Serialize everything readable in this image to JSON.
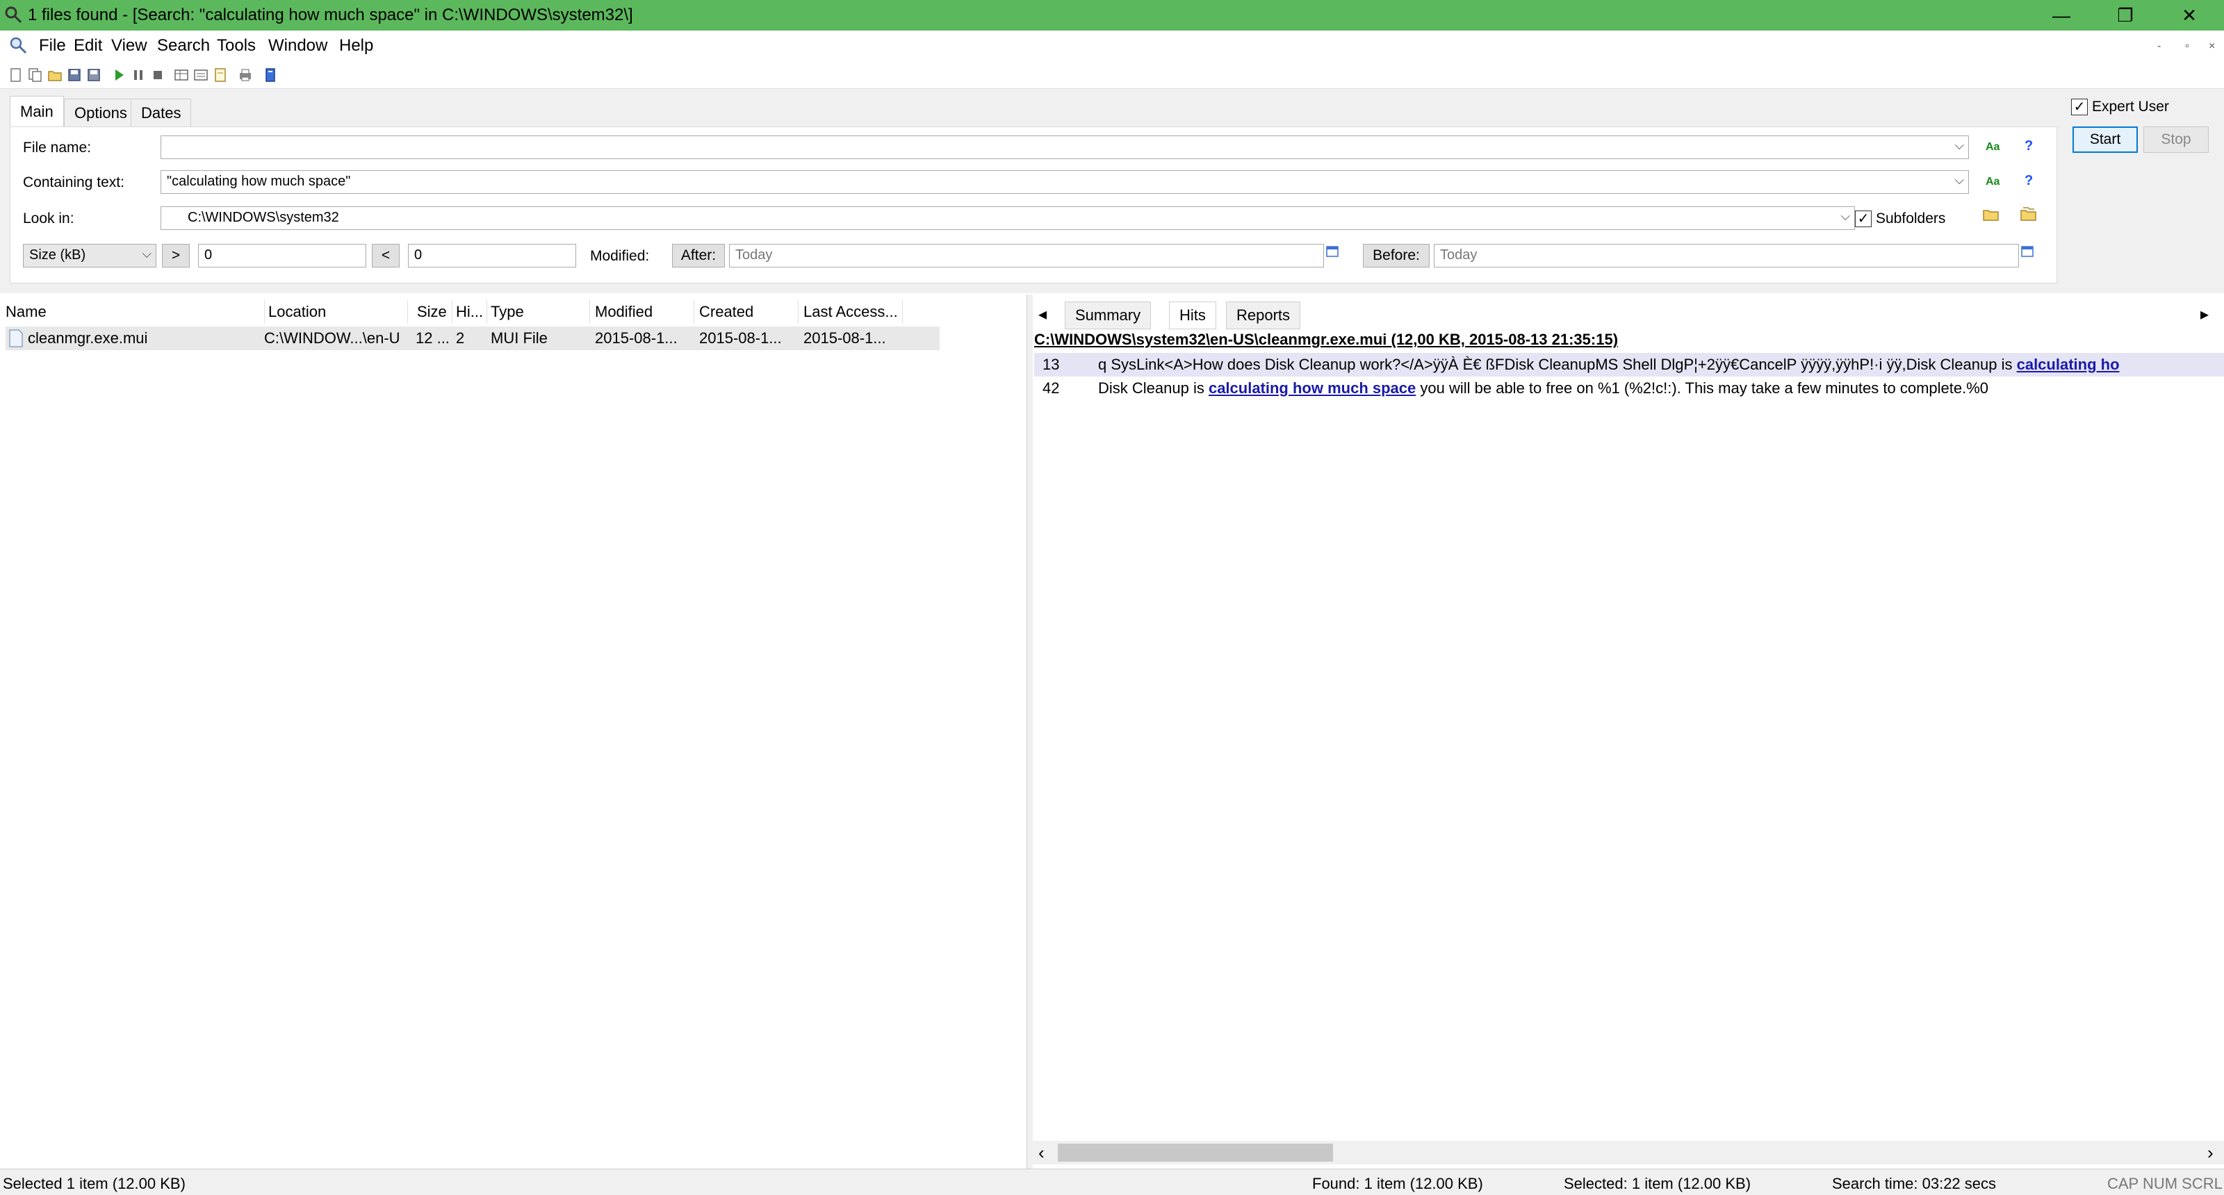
{
  "window": {
    "title": "1 files found - [Search: \"calculating how much space\" in C:\\WINDOWS\\system32\\]",
    "minimize": "—",
    "restore": "❐",
    "close": "✕",
    "title_bar_color": "#5cb85c"
  },
  "menu": {
    "items": [
      "File",
      "Edit",
      "View",
      "Search",
      "Tools",
      "Window",
      "Help"
    ],
    "mdi_controls": [
      "-",
      "▫",
      "×"
    ]
  },
  "toolbar": {
    "icons": [
      "new-icon",
      "new-from-icon",
      "open-icon",
      "save-icon",
      "save-as-icon",
      "start-icon",
      "pause-icon",
      "stop-icon",
      "grid-icon",
      "report-icon",
      "export-icon",
      "print-icon",
      "info-icon"
    ]
  },
  "search_tabs": [
    "Main",
    "Options",
    "Dates"
  ],
  "search": {
    "file_name_label": "File name:",
    "file_name_value": "",
    "containing_text_label": "Containing text:",
    "containing_text_value": "\"calculating how much space\"",
    "look_in_label": "Look in:",
    "look_in_value": "C:\\WINDOWS\\system32",
    "subfolders_label": "Subfolders",
    "subfolders_checked": true,
    "size_unit": "Size (kB)",
    "greater_than": ">",
    "greater_value": "0",
    "less_than": "<",
    "less_value": "0",
    "modified_label": "Modified:",
    "after_label": "After:",
    "after_value": "Today",
    "before_label": "Before:",
    "before_value": "Today",
    "case_icon": "Aa",
    "help_icon": "?"
  },
  "actions": {
    "expert_user_label": "Expert User",
    "expert_user_checked": true,
    "start_label": "Start",
    "stop_label": "Stop"
  },
  "results": {
    "columns": [
      "Name",
      "Location",
      "Size",
      "Hi...",
      "Type",
      "Modified",
      "Created",
      "Last Access..."
    ],
    "rows": [
      {
        "name": "cleanmgr.exe.mui",
        "location": "C:\\WINDOW...\\en-U",
        "size": "12 ...",
        "hits": "2",
        "type": "MUI File",
        "modified": "2015-08-1...",
        "created": "2015-08-1...",
        "last_access": "2015-08-1..."
      }
    ]
  },
  "preview": {
    "tabs": [
      "Summary",
      "Hits",
      "Reports"
    ],
    "active_tab": "Hits",
    "header": "C:\\WINDOWS\\system32\\en-US\\cleanmgr.exe.mui   (12,00 KB,  2015-08-13 21:35:15)",
    "hits": [
      {
        "line": "13",
        "before": "q SysLink<A>How does Disk Cleanup work?</A>ÿÿÀ È€ ßFDisk CleanupMS Shell DlgP¦+2ÿÿ€CancelP ÿÿÿÿ,ÿÿhP!·i ÿÿ,Disk Cleanup is ",
        "match": "calculating ho",
        "after": ""
      },
      {
        "line": "42",
        "before": "Disk Cleanup is ",
        "match": "calculating how much space",
        "after": " you will be able to free on %1 (%2!c!:). This may take a few minutes to complete.%0"
      }
    ]
  },
  "status": {
    "selected_left": "Selected 1 item (12.00 KB)",
    "found": "Found: 1 item (12.00 KB)",
    "selected_right": "Selected: 1 item (12.00 KB)",
    "search_time": "Search time: 03:22 secs",
    "indicators": "CAP NUM SCRL"
  },
  "scroll": {
    "left_arrow": "‹",
    "right_arrow": "›"
  }
}
